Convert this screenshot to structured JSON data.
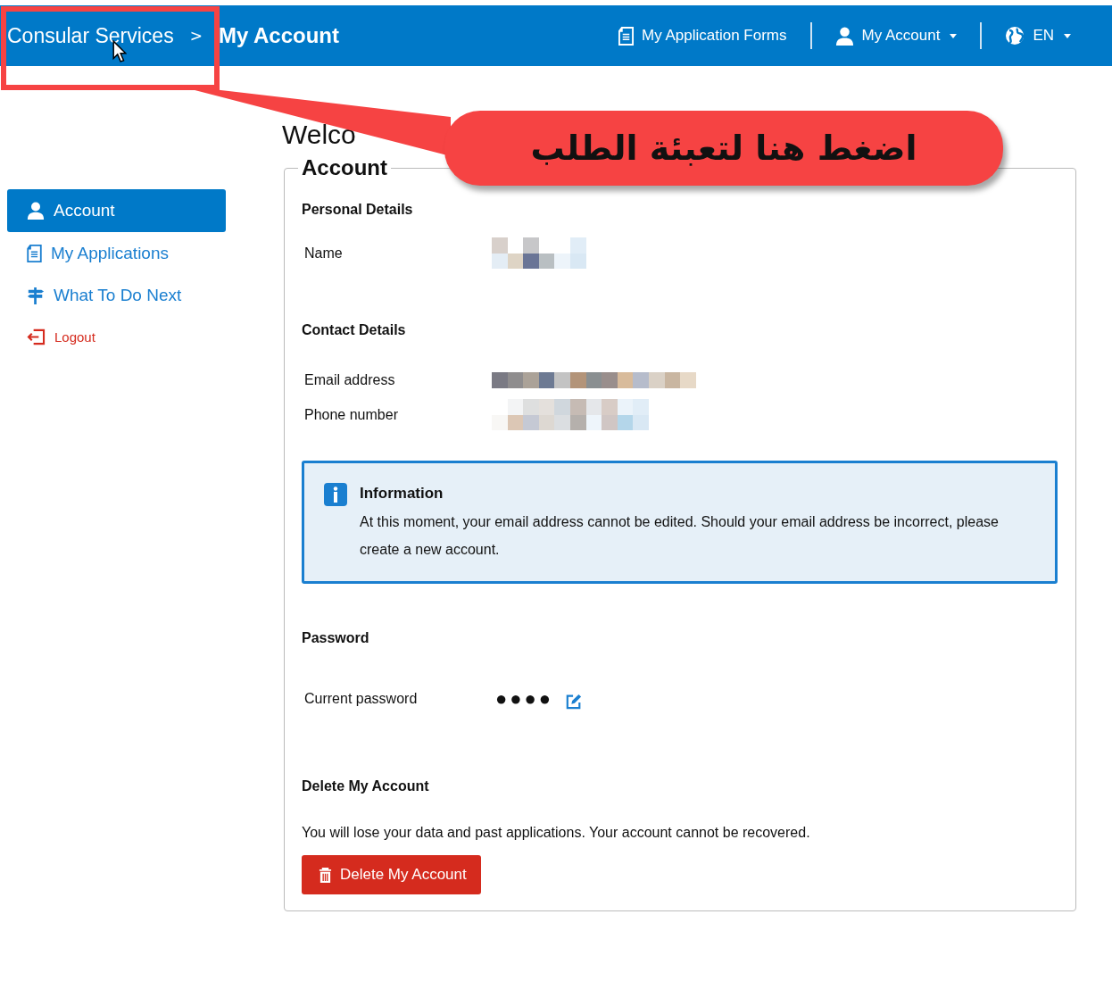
{
  "header": {
    "breadcrumb": [
      {
        "label": "Consular Services",
        "current": false
      },
      {
        "label": "My Account",
        "current": true
      }
    ],
    "separator": ">",
    "nav": [
      {
        "kind": "forms",
        "label": "My Application Forms",
        "dropdown": false
      },
      {
        "kind": "account",
        "label": "My Account",
        "dropdown": true
      },
      {
        "kind": "language",
        "label": "EN",
        "dropdown": true
      }
    ]
  },
  "welcome": "Welco",
  "annotation": {
    "text": "اضغط هنا لتعبئة الطلب"
  },
  "sidebar": {
    "items": [
      {
        "kind": "account",
        "label": "Account",
        "selected": true
      },
      {
        "kind": "applications",
        "label": "My Applications",
        "selected": false
      },
      {
        "kind": "next",
        "label": "What To Do Next",
        "selected": false
      },
      {
        "kind": "logout",
        "label": "Logout",
        "selected": false
      }
    ]
  },
  "account": {
    "title": "Account",
    "personal": {
      "heading": "Personal Details",
      "name_label": "Name"
    },
    "contact": {
      "heading": "Contact Details",
      "email_label": "Email address",
      "phone_label": "Phone number"
    },
    "info": {
      "title": "Information",
      "text": "At this moment, your email address cannot be edited. Should your email address be incorrect, please create a new account."
    },
    "password": {
      "heading": "Password",
      "label": "Current password",
      "value": "●●●●"
    },
    "delete": {
      "heading": "Delete My Account",
      "text": "You will lose your data and past applications. Your account cannot be recovered.",
      "button": "Delete My Account"
    }
  }
}
